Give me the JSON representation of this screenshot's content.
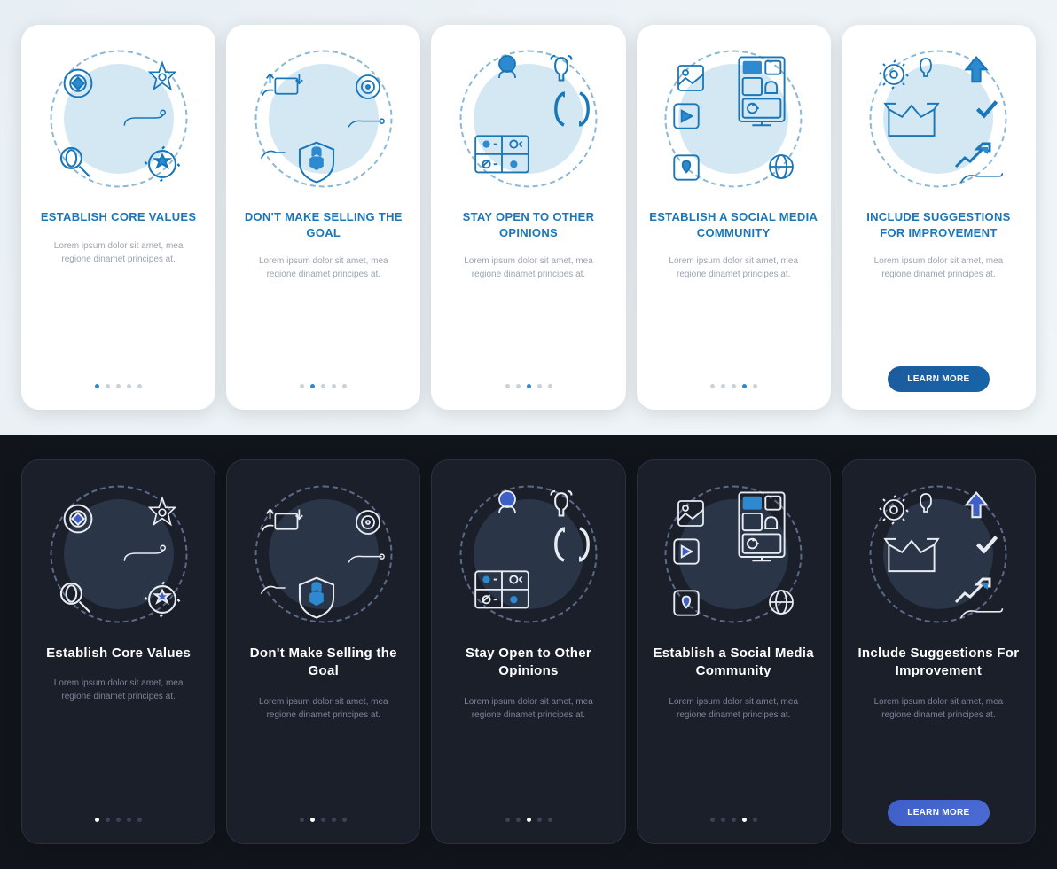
{
  "light": {
    "cards": [
      {
        "title": "ESTABLISH CORE VALUES",
        "body": "Lorem ipsum dolor sit amet, mea regione dinamet principes at.",
        "active": 0,
        "cta": false
      },
      {
        "title": "DON'T MAKE SELLING THE GOAL",
        "body": "Lorem ipsum dolor sit amet, mea regione dinamet principes at.",
        "active": 1,
        "cta": false
      },
      {
        "title": "STAY OPEN TO OTHER OPINIONS",
        "body": "Lorem ipsum dolor sit amet, mea regione dinamet principes at.",
        "active": 2,
        "cta": false
      },
      {
        "title": "ESTABLISH A SOCIAL MEDIA COMMUNITY",
        "body": "Lorem ipsum dolor sit amet, mea regione dinamet principes at.",
        "active": 3,
        "cta": false
      },
      {
        "title": "INCLUDE SUGGESTIONS FOR IMPROVEMENT",
        "body": "Lorem ipsum dolor sit amet, mea regione dinamet principes at.",
        "active": 4,
        "cta": true
      }
    ]
  },
  "dark": {
    "cards": [
      {
        "title": "Establish Core Values",
        "body": "Lorem ipsum dolor sit amet, mea regione dinamet principes at.",
        "active": 0,
        "cta": false
      },
      {
        "title": "Don't Make Selling the Goal",
        "body": "Lorem ipsum dolor sit amet, mea regione dinamet principes at.",
        "active": 1,
        "cta": false
      },
      {
        "title": "Stay Open to Other Opinions",
        "body": "Lorem ipsum dolor sit amet, mea regione dinamet principes at.",
        "active": 2,
        "cta": false
      },
      {
        "title": "Establish a Social Media Community",
        "body": "Lorem ipsum dolor sit amet, mea regione dinamet principes at.",
        "active": 3,
        "cta": false
      },
      {
        "title": "Include Suggestions For Improvement",
        "body": "Lorem ipsum dolor sit amet, mea regione dinamet principes at.",
        "active": 4,
        "cta": true
      }
    ]
  },
  "cta_label": "LEARN MORE"
}
